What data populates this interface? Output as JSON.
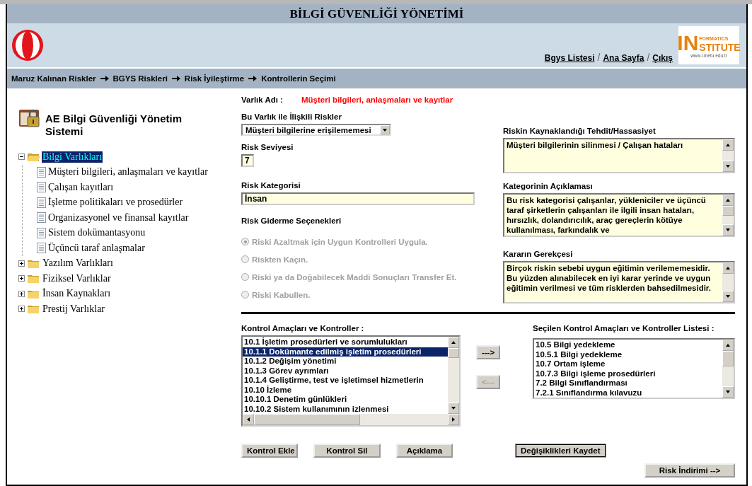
{
  "header": {
    "title": "BİLGİ GÜVENLİĞİ YÖNETİMİ",
    "links": [
      "Bgys Listesi",
      "Ana Sayfa",
      "Çıkış"
    ],
    "separator": "/",
    "logo": {
      "big": "IN",
      "top": "FORMATICS",
      "word": "STITUTE",
      "url": "www.i.metu.edu.tr"
    }
  },
  "breadcrumb": [
    "Maruz Kalınan Riskler",
    "BGYS Riskleri",
    "Risk İyileştirme",
    "Kontrollerin Seçimi"
  ],
  "sidebar": {
    "title": "AE Bilgi Güvenliği Yönetim Sistemi",
    "tree": [
      {
        "label": "Bilgi Varlıkları",
        "expanded": true,
        "selected": true,
        "children": [
          {
            "label": "Müşteri bilgileri, anlaşmaları ve kayıtlar"
          },
          {
            "label": "Çalışan kayıtları"
          },
          {
            "label": "İşletme politikaları ve prosedürler"
          },
          {
            "label": "Organizasyonel ve finansal kayıtlar"
          },
          {
            "label": "Sistem dokümantasyonu"
          },
          {
            "label": "Üçüncü taraf anlaşmalar"
          }
        ]
      },
      {
        "label": "Yazılım Varlıkları",
        "expanded": false,
        "selected": false
      },
      {
        "label": "Fiziksel Varlıklar",
        "expanded": false,
        "selected": false
      },
      {
        "label": "İnsan Kaynakları",
        "expanded": false,
        "selected": false
      },
      {
        "label": "Prestij Varlıklar",
        "expanded": false,
        "selected": false
      }
    ]
  },
  "form": {
    "asset_label": "Varlık Adı :",
    "asset_name": "Müşteri bilgileri, anlaşmaları ve kayıtlar",
    "related_risks": {
      "label": "Bu Varlık ile İlişkili Riskler",
      "value": "Müşteri bilgilerine erişilememesi"
    },
    "risk_level": {
      "label": "Risk Seviyesi",
      "value": "7"
    },
    "risk_category": {
      "label": "Risk Kategorisi",
      "value": "İnsan"
    },
    "options": {
      "label": "Risk Giderme Seçenekleri",
      "items": [
        {
          "label": "Riski Azaltmak için Uygun Kontrolleri Uygula.",
          "selected": true,
          "disabled": true
        },
        {
          "label": "Riskten Kaçın.",
          "selected": false,
          "disabled": true
        },
        {
          "label": "Riski ya da Doğabilecek Maddi Sonuçları Transfer Et.",
          "selected": false,
          "disabled": true
        },
        {
          "label": "Riski Kabullen.",
          "selected": false,
          "disabled": true
        }
      ]
    },
    "threat": {
      "label": "Riskin Kaynaklandığı Tehdit/Hassasiyet",
      "value": "Müşteri bilgilerinin silinmesi / Çalışan hataları"
    },
    "category_description": {
      "label": "Kategorinin Açıklaması",
      "value": "Bu risk kategorisi çalışanlar, yükleniciler ve üçüncü taraf şirketlerin çalışanları ile ilgili insan hataları, hırsızlık, dolandırıcılık, araç gereçlerin kötüye kullanılması, farkındalık ve"
    },
    "rationale": {
      "label": "Kararın Gerekçesi",
      "value": "Birçok riskin sebebi uygun eğitimin verilememesidir. Bu yüzden alınabilecek en iyi karar yerinde ve uygun eğitimin verilmesi ve tüm risklerden bahsedilmesidir."
    }
  },
  "controls": {
    "label": "Kontrol Amaçları ve Kontroller :",
    "items": [
      {
        "label": "10.1 İşletim prosedürleri ve sorumlulukları",
        "selected": false
      },
      {
        "label": "10.1.1 Dokümante edilmiş işletim prosedürleri",
        "selected": true
      },
      {
        "label": "10.1.2 Değişim yönetimi",
        "selected": false
      },
      {
        "label": "10.1.3 Görev ayrımları",
        "selected": false
      },
      {
        "label": "10.1.4 Geliştirme, test ve işletimsel hizmetlerin",
        "selected": false
      },
      {
        "label": "10.10 İzleme",
        "selected": false
      },
      {
        "label": "10.10.1 Denetim günlükleri",
        "selected": false
      },
      {
        "label": "10.10.2 Sistem kullanımının izlenmesi",
        "selected": false
      }
    ]
  },
  "move_buttons": [
    {
      "label": "--->",
      "disabled": false
    },
    {
      "label": "<---",
      "disabled": true
    }
  ],
  "selected_controls": {
    "label": "Seçilen Kontrol Amaçları ve Kontroller Listesi :",
    "items": [
      "10.5 Bilgi yedekleme",
      "10.5.1 Bilgi yedekleme",
      "10.7 Ortam işleme",
      "10.7.3 Bilgi işleme prosedürleri",
      "7.2 Bilgi Sınıflandırması",
      "7.2.1 Sınıflandırma kılavuzu"
    ]
  },
  "buttons": [
    "Kontrol Ekle",
    "Kontrol Sil",
    "Açıklama"
  ],
  "save_button": "Değişiklikleri Kaydet",
  "next_button": "Risk İndirimi -->"
}
